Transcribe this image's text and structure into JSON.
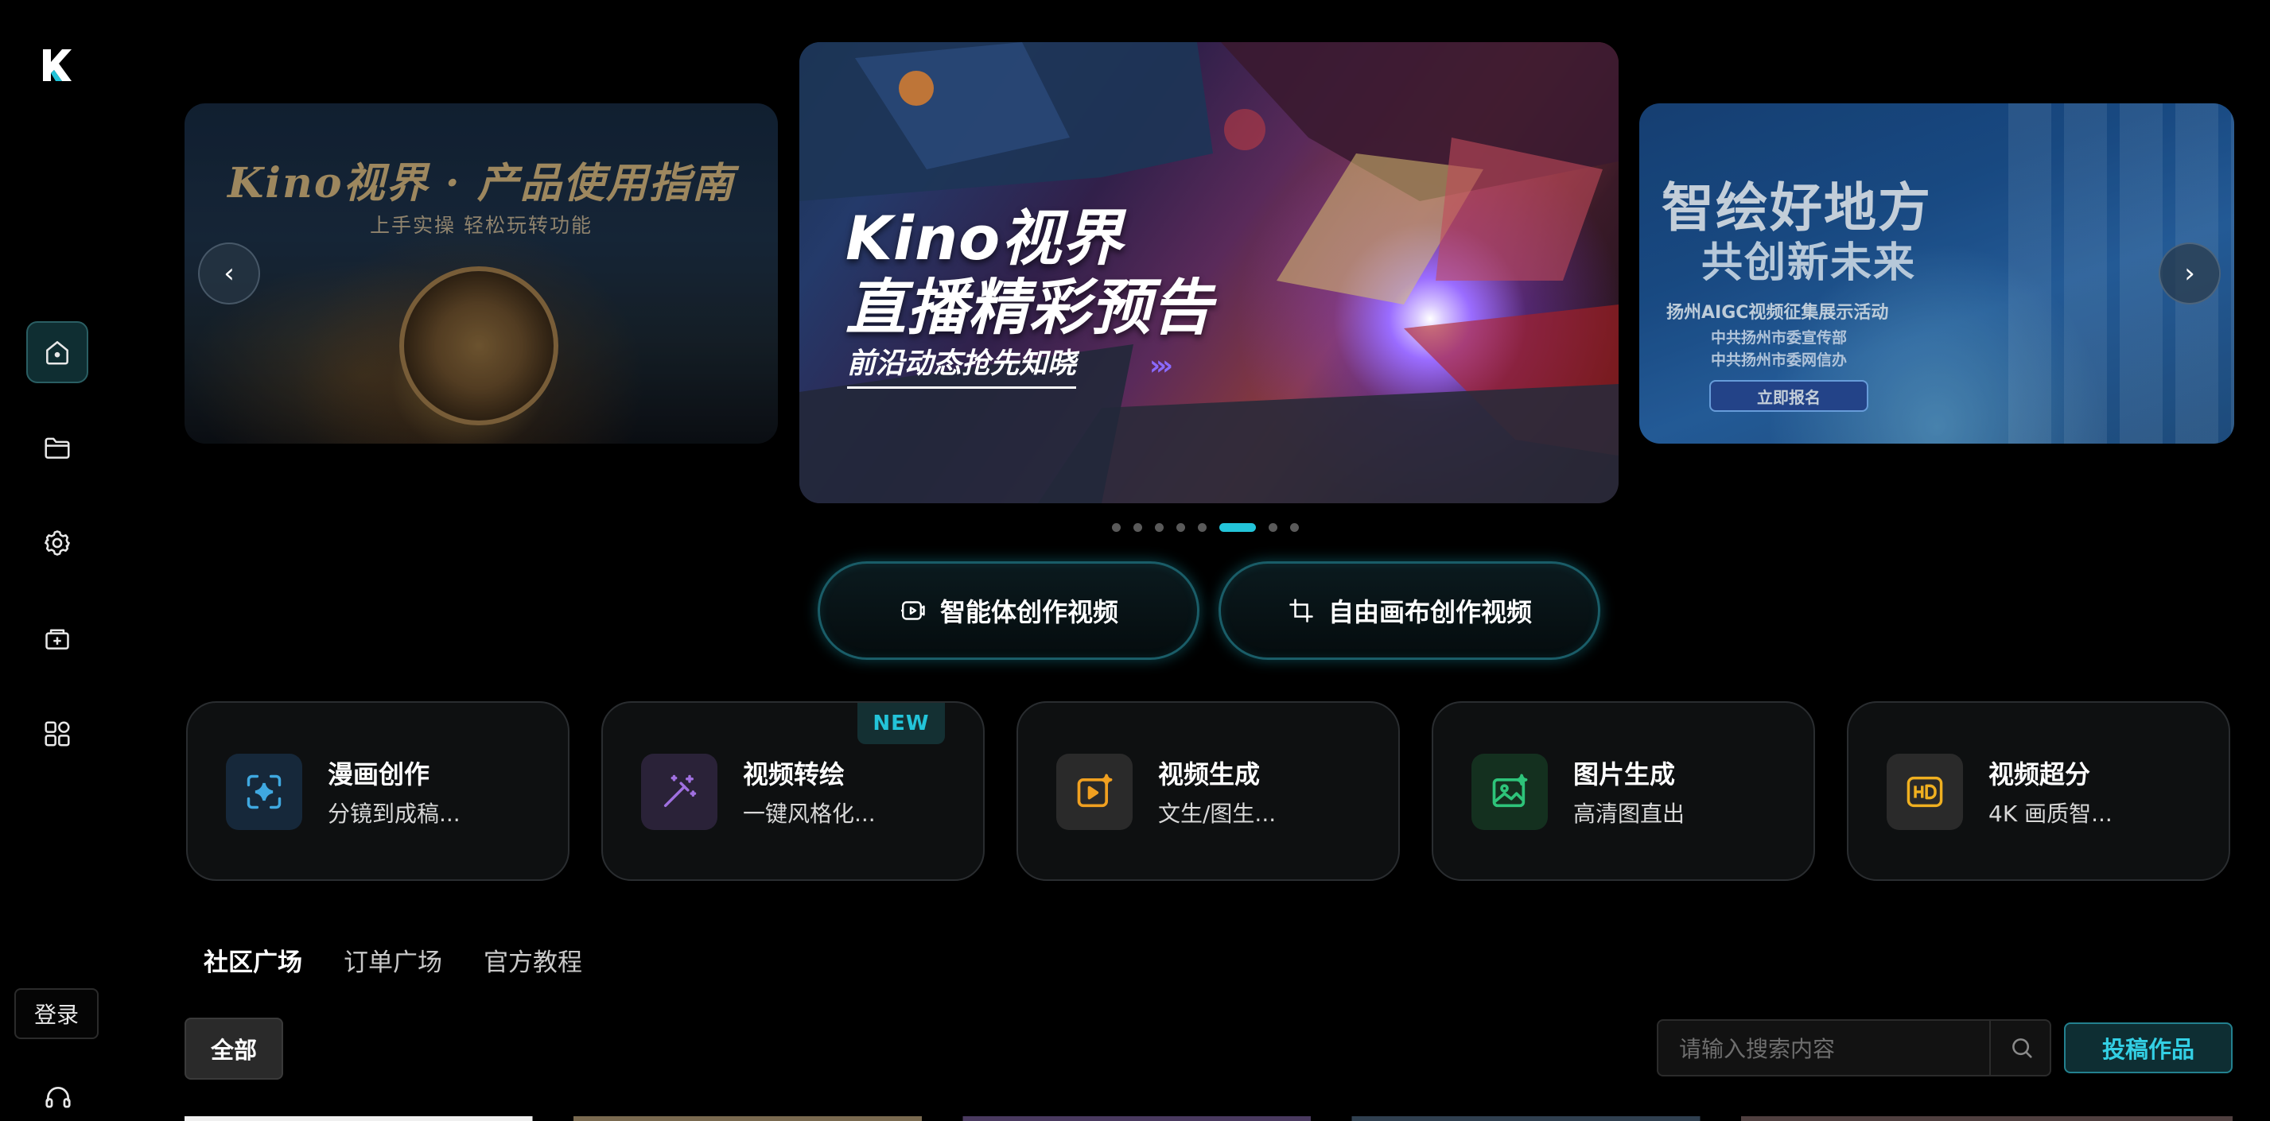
{
  "brand": {
    "logo_letter": "K"
  },
  "sidebar": {
    "items": [
      {
        "name": "home",
        "active": true
      },
      {
        "name": "folder",
        "active": false
      },
      {
        "name": "settings",
        "active": false
      },
      {
        "name": "add-box",
        "active": false
      },
      {
        "name": "apps",
        "active": false
      }
    ],
    "login_label": "登录"
  },
  "carousel": {
    "left": {
      "title": "Kino视界 · 产品使用指南",
      "subtitle": "上手实操  轻松玩转功能"
    },
    "center": {
      "title_line1": "Kino视界",
      "title_line2": "直播精彩预告",
      "subtitle": "前沿动态抢先知晓"
    },
    "right": {
      "title_line1": "智绘好地方",
      "title_line2": "共创新未来",
      "line1": "扬州AIGC视频征集展示活动",
      "line2": "中共扬州市委宣传部",
      "line3": "中共扬州市委网信办",
      "button": "立即报名"
    },
    "dot_count": 8,
    "active_index": 5,
    "prev_arrow": "‹",
    "next_arrow": "›"
  },
  "modes": [
    {
      "label": "智能体创作视频",
      "icon": "video-agent-icon"
    },
    {
      "label": "自由画布创作视频",
      "icon": "crop-canvas-icon"
    }
  ],
  "features": [
    {
      "title": "漫画创作",
      "subtitle": "分镜到成稿...",
      "icon": "sparkle-frame-icon",
      "color": "#3fa8e0",
      "bg": "#16283a"
    },
    {
      "title": "视频转绘",
      "subtitle": "一键风格化...",
      "icon": "magic-wand-icon",
      "color": "#a070e0",
      "bg": "#2a2238",
      "badge": "NEW"
    },
    {
      "title": "视频生成",
      "subtitle": "文生/图生...",
      "icon": "video-sparkle-icon",
      "color": "#f0a020",
      "bg": "#2a2a2a"
    },
    {
      "title": "图片生成",
      "subtitle": "高清图直出",
      "icon": "image-icon",
      "color": "#2ec47a",
      "bg": "#14301f"
    },
    {
      "title": "视频超分",
      "subtitle": "4K 画质智...",
      "icon": "hd-icon",
      "color": "#f0b020",
      "bg": "#2a2a2a"
    }
  ],
  "tabs": [
    {
      "label": "社区广场",
      "active": true
    },
    {
      "label": "订单广场",
      "active": false
    },
    {
      "label": "官方教程",
      "active": false
    }
  ],
  "filter": {
    "all_label": "全部"
  },
  "search": {
    "placeholder": "请输入搜索内容",
    "value": ""
  },
  "submit_label": "投稿作品"
}
